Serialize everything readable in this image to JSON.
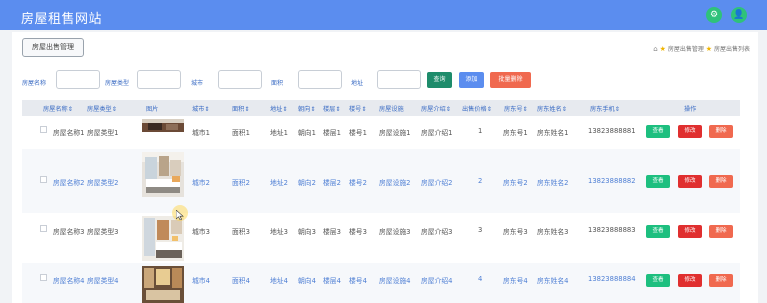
{
  "header": {
    "title": "房屋租售网站",
    "icon_left": "⚙",
    "icon_right": "👤"
  },
  "toolbar": {
    "module_button": "房屋出售管理"
  },
  "breadcrumb": {
    "item1": "房屋出售管理",
    "item2": "房屋出售列表"
  },
  "filters": {
    "name_label": "房屋名称",
    "type_label": "房屋类型",
    "city_label": "城市",
    "area_label": "面积",
    "address_label": "地址",
    "query": "查询",
    "add": "添加",
    "batch_delete": "批量删除"
  },
  "table": {
    "headers": [
      "房屋名称⇕",
      "房屋类型⇕",
      "图片",
      "城市⇕",
      "面积⇕",
      "地址⇕",
      "朝向⇕",
      "楼层⇕",
      "楼号⇕",
      "房屋设施",
      "房屋介绍⇕",
      "出售价格⇕",
      "房东号⇕",
      "房东姓名⇕",
      "房东手机⇕",
      "操作"
    ],
    "rows": [
      {
        "name": "房屋名称1",
        "type": "房屋类型1",
        "city": "城市1",
        "area": "面积1",
        "address": "地址1",
        "orientation": "朝向1",
        "floor": "楼层1",
        "building": "楼号1",
        "facility": "房屋设施1",
        "intro": "房屋介绍1",
        "price": "1",
        "landlord_no": "房东号1",
        "landlord_name": "房东姓名1",
        "phone": "13823888881"
      },
      {
        "name": "房屋名称2",
        "type": "房屋类型2",
        "city": "城市2",
        "area": "面积2",
        "address": "地址2",
        "orientation": "朝向2",
        "floor": "楼层2",
        "building": "楼号2",
        "facility": "房屋设施2",
        "intro": "房屋介绍2",
        "price": "2",
        "landlord_no": "房东号2",
        "landlord_name": "房东姓名2",
        "phone": "13823888882"
      },
      {
        "name": "房屋名称3",
        "type": "房屋类型3",
        "city": "城市3",
        "area": "面积3",
        "address": "地址3",
        "orientation": "朝向3",
        "floor": "楼层3",
        "building": "楼号3",
        "facility": "房屋设施3",
        "intro": "房屋介绍3",
        "price": "3",
        "landlord_no": "房东号3",
        "landlord_name": "房东姓名3",
        "phone": "13823888883"
      },
      {
        "name": "房屋名称4",
        "type": "房屋类型4",
        "city": "城市4",
        "area": "面积4",
        "address": "地址4",
        "orientation": "朝向4",
        "floor": "楼层4",
        "building": "楼号4",
        "facility": "房屋设施4",
        "intro": "房屋介绍4",
        "price": "4",
        "landlord_no": "房东号4",
        "landlord_name": "房东姓名4",
        "phone": "13823888884"
      }
    ],
    "actions": {
      "view": "查看",
      "edit": "修改",
      "delete": "删除"
    }
  },
  "colors": {
    "header_bg": "#5b8def",
    "query_btn": "#1e8c6b",
    "add_btn": "#5b8def",
    "batch_delete_btn": "#f0694f",
    "view_btn": "#1dbf7f",
    "edit_btn": "#e02f2f",
    "delete_btn": "#f0694f"
  }
}
